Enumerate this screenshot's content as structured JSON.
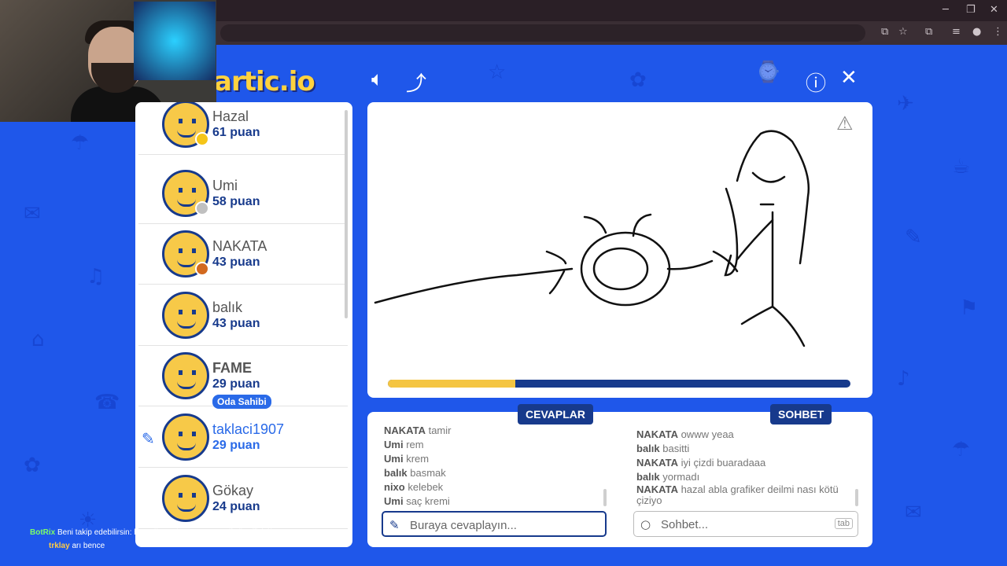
{
  "browser": {
    "window_controls": [
      "─",
      "❐",
      "✕"
    ],
    "toolbar_icons": [
      "⧉",
      "☆",
      "⧉",
      "≡",
      "●",
      "⋮"
    ]
  },
  "game": {
    "logo": "artic.io",
    "players": [
      {
        "name": "Hazal",
        "points": "61 puan",
        "dot": "#f5c518"
      },
      {
        "name": "Umi",
        "points": "58 puan",
        "dot": "#c0c0c0"
      },
      {
        "name": "NAKATA",
        "points": "43 puan",
        "dot": "#d2691e"
      },
      {
        "name": "balık",
        "points": "43 puan"
      },
      {
        "name": "FAME",
        "points": "29 puan",
        "badge": "Oda Sahibi"
      },
      {
        "name": "taklaci1907",
        "points": "29 puan",
        "drawing": true
      },
      {
        "name": "Gökay",
        "points": "24 puan"
      }
    ],
    "progress_fraction": 0.275,
    "answers_tab": "CEVAPLAR",
    "chat_tab": "SOHBET",
    "answers": [
      {
        "user": "NAKATA",
        "text": "tamir"
      },
      {
        "user": "Umi",
        "text": "rem"
      },
      {
        "user": "Umi",
        "text": "krem"
      },
      {
        "user": "balık",
        "text": "basmak"
      },
      {
        "user": "nixo",
        "text": "kelebek"
      },
      {
        "user": "Umi",
        "text": "saç kremi"
      }
    ],
    "chat": [
      {
        "user": "NAKATA",
        "text": "owww yeaa"
      },
      {
        "user": "balık",
        "text": "basitti"
      },
      {
        "user": "NAKATA",
        "text": "iyi çizdi buaradaaa"
      },
      {
        "user": "balık",
        "text": "yormadı"
      },
      {
        "user": "NAKATA",
        "text": "hazal abla grafiker deilmi nası kötü çiziyo"
      }
    ],
    "answer_placeholder": "Buraya cevaplayın...",
    "chat_placeholder": "Sohbet...",
    "tab_key": "tab"
  },
  "stream_overlay": {
    "line1_user": "BotRix",
    "line1_text": "Beni takip edebilirsin: https://www.instagram.com/fatih.official/",
    "line2_user": "trklay",
    "line2_text": "arı bence"
  }
}
